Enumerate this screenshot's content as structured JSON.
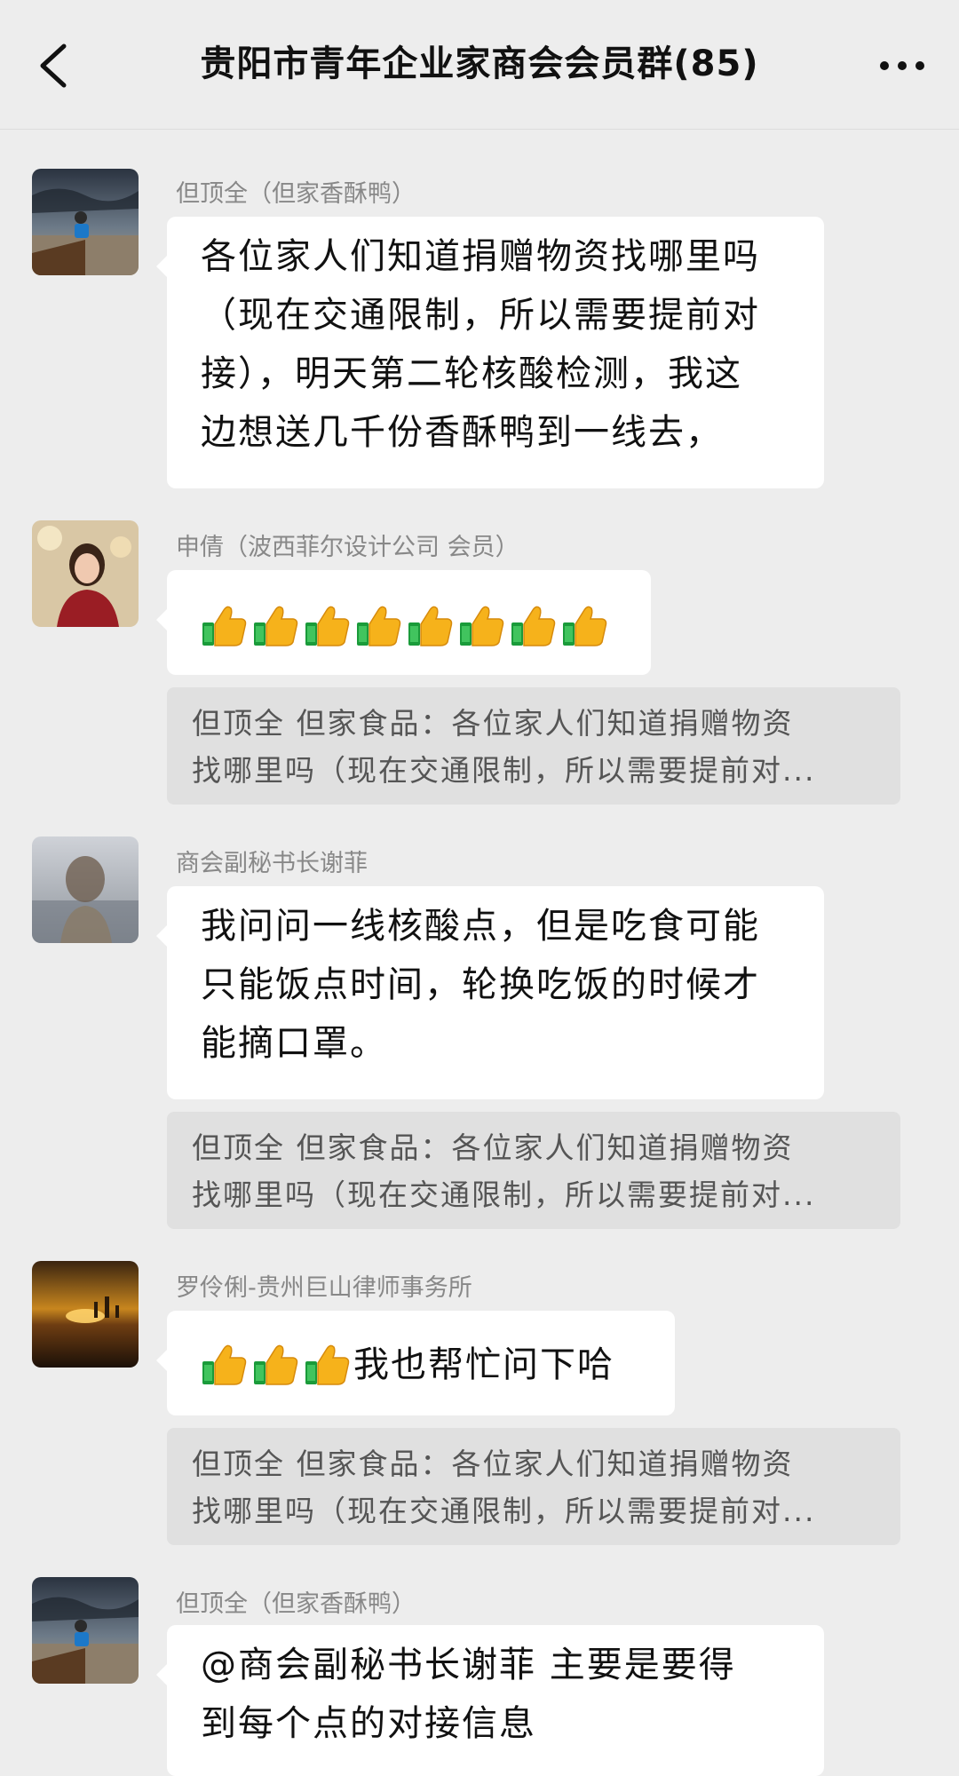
{
  "header": {
    "title": "贵阳市青年企业家商会会员群(85)",
    "back_icon": "chevron-left-icon",
    "more_icon": "more-horizontal-icon"
  },
  "messages": [
    {
      "sender": "但顶全（但家香酥鸭）",
      "lines": [
        "各位家人们知道捐赠物资找哪里吗",
        "（现在交通限制，所以需要提前对",
        "接），明天第二轮核酸检测，我这",
        "边想送几千份香酥鸭到一线去，"
      ]
    },
    {
      "sender": "申倩（波西菲尔设计公司 会员）",
      "emoji": "thumbs-up-icon",
      "emoji_count": 8,
      "quote_lines": [
        "但顶全 但家食品：各位家人们知道捐赠物资",
        "找哪里吗（现在交通限制，所以需要提前对..."
      ]
    },
    {
      "sender": "商会副秘书长谢菲",
      "lines": [
        "我问问一线核酸点，但是吃食可能",
        "只能饭点时间，轮换吃饭的时候才",
        "能摘口罩。"
      ],
      "quote_lines": [
        "但顶全 但家食品：各位家人们知道捐赠物资",
        "找哪里吗（现在交通限制，所以需要提前对..."
      ]
    },
    {
      "sender": "罗伶俐-贵州巨山律师事务所",
      "emoji": "thumbs-up-icon",
      "emoji_count": 3,
      "text": "我也帮忙问下哈",
      "quote_lines": [
        "但顶全 但家食品：各位家人们知道捐赠物资",
        "找哪里吗（现在交通限制，所以需要提前对..."
      ]
    },
    {
      "sender": "但顶全（但家香酥鸭）",
      "lines": [
        "@商会副秘书长谢菲  主要是要得",
        "到每个点的对接信息"
      ]
    }
  ]
}
